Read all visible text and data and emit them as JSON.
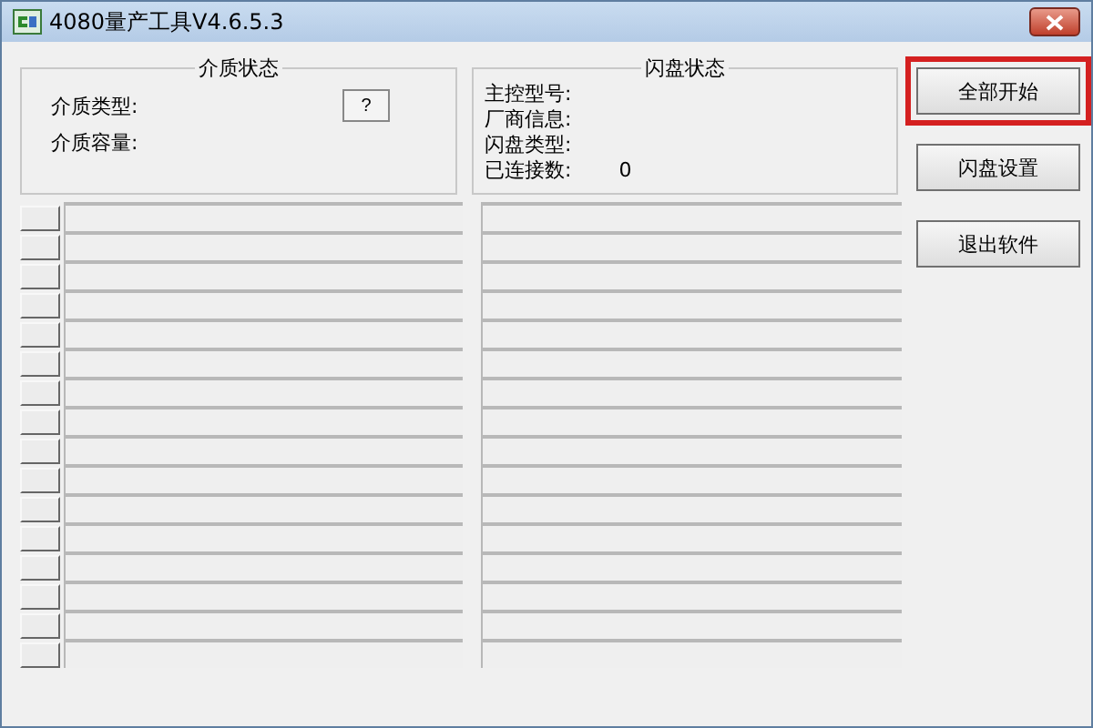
{
  "window": {
    "title": "4080量产工具V4.6.5.3"
  },
  "media_status": {
    "title": "介质状态",
    "fields": [
      {
        "label": "介质类型:"
      },
      {
        "label": "介质容量:"
      }
    ],
    "help_button": "?"
  },
  "flash_status": {
    "title": "闪盘状态",
    "fields": [
      {
        "label": "主控型号:"
      },
      {
        "label": "厂商信息:"
      },
      {
        "label": "闪盘类型:"
      },
      {
        "label": "已连接数:",
        "value": "0"
      }
    ]
  },
  "buttons": [
    {
      "label": "全部开始",
      "highlighted": true
    },
    {
      "label": "闪盘设置",
      "highlighted": false
    },
    {
      "label": "退出软件",
      "highlighted": false
    }
  ],
  "slot_rows": [
    {
      "kind": "slot"
    },
    {
      "kind": "slot"
    },
    {
      "kind": "slot"
    },
    {
      "kind": "slot"
    },
    {
      "kind": "slot"
    },
    {
      "kind": "slot"
    },
    {
      "kind": "slot"
    },
    {
      "kind": "slot"
    },
    {
      "kind": "slot"
    },
    {
      "kind": "slot"
    },
    {
      "kind": "slot"
    },
    {
      "kind": "slot"
    },
    {
      "kind": "slot"
    },
    {
      "kind": "slot"
    },
    {
      "kind": "slot"
    },
    {
      "kind": "slot"
    }
  ]
}
